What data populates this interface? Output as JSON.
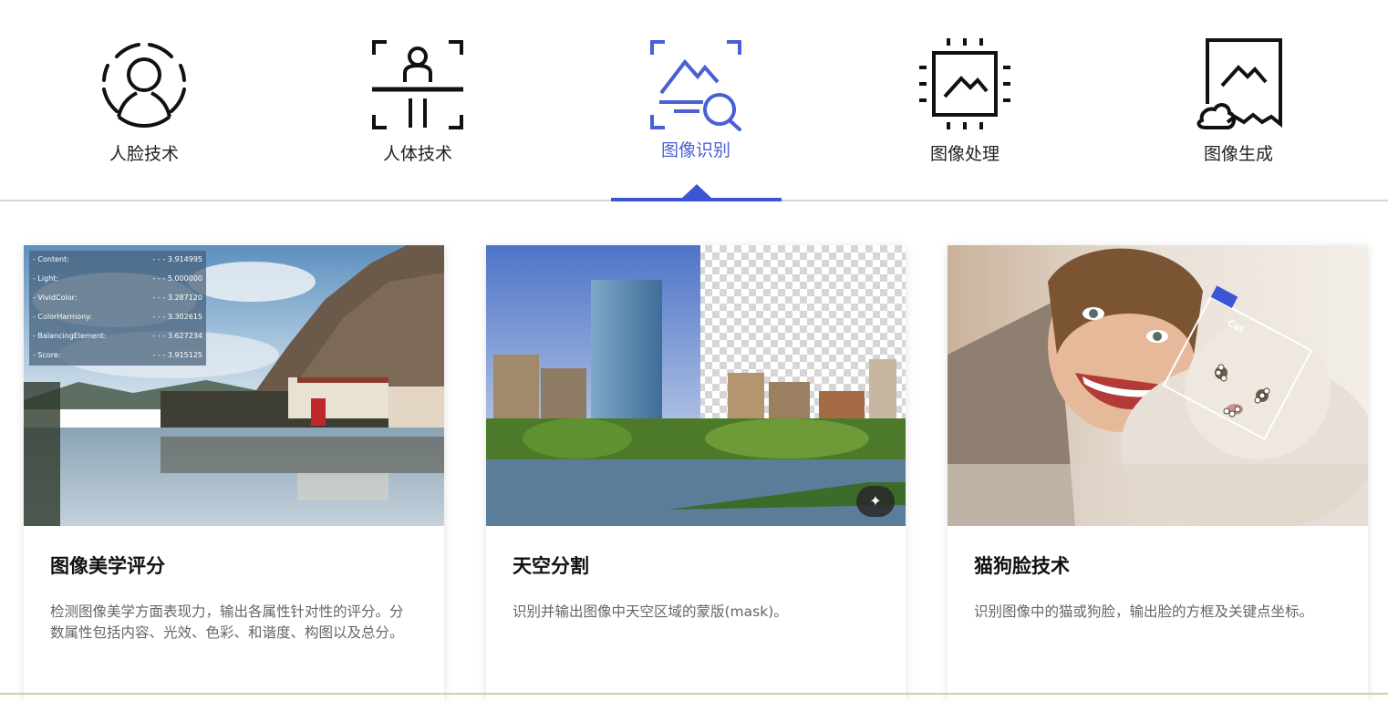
{
  "tabs": [
    {
      "label": "人脸技术",
      "icon": "face-scan-icon",
      "active": false
    },
    {
      "label": "人体技术",
      "icon": "body-scan-icon",
      "active": false
    },
    {
      "label": "图像识别",
      "icon": "image-search-icon",
      "active": true
    },
    {
      "label": "图像处理",
      "icon": "image-chip-icon",
      "active": false
    },
    {
      "label": "图像生成",
      "icon": "image-generate-icon",
      "active": false
    }
  ],
  "colors": {
    "accent": "#3c55d3",
    "active_text": "#4a5fd6"
  },
  "cards": [
    {
      "title": "图像美学评分",
      "desc": "检测图像美学方面表现力，输出各属性针对性的评分。分数属性包括内容、光效、色彩、和谐度、构图以及总分。",
      "scores": [
        {
          "label": "- Content:",
          "value": "- - - 3.914995"
        },
        {
          "label": "- Light:",
          "value": "- - - 5.000000"
        },
        {
          "label": "- VividColor:",
          "value": "- - - 3.287120"
        },
        {
          "label": "- ColorHarmony:",
          "value": "- - - 3.302615"
        },
        {
          "label": "- BalancingElement:",
          "value": "- - - 3.627234"
        },
        {
          "label": "- Score:",
          "value": "- - - 3.915125"
        }
      ]
    },
    {
      "title": "天空分割",
      "desc": "识别并输出图像中天空区域的蒙版(mask)。",
      "button_icon": "magic-wand-icon"
    },
    {
      "title": "猫狗脸技术",
      "desc": "识别图像中的猫或狗脸，输出脸的方框及关键点坐标。",
      "detection_label": "Cat"
    }
  ]
}
